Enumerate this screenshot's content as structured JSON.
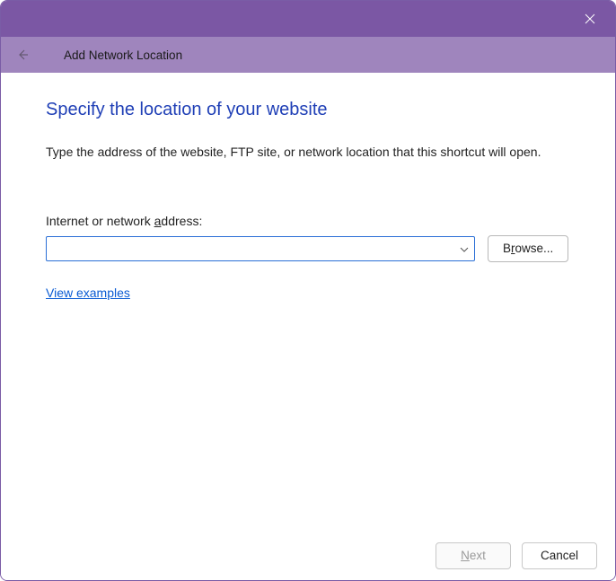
{
  "titlebar": {
    "close_icon": "close"
  },
  "subheader": {
    "back_icon": "back-arrow",
    "title": "Add Network Location"
  },
  "main": {
    "heading": "Specify the location of your website",
    "description": "Type the address of the website, FTP site, or network location that this shortcut will open.",
    "address_label_pre": "Internet or network ",
    "address_label_u": "a",
    "address_label_post": "ddress:",
    "address_value": "",
    "browse_pre": "B",
    "browse_u": "r",
    "browse_post": "owse...",
    "examples_link": "View examples"
  },
  "footer": {
    "next_u": "N",
    "next_post": "ext",
    "cancel": "Cancel"
  }
}
